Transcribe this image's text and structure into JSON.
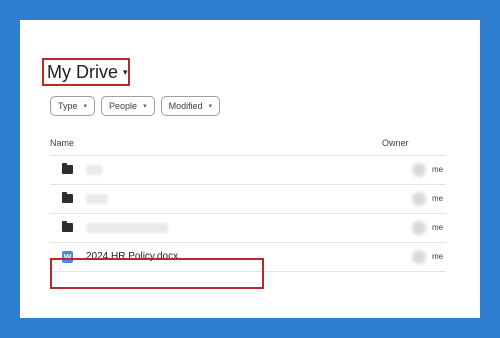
{
  "header": {
    "title": "My Drive",
    "title_caret": "▾"
  },
  "filters": [
    {
      "label": "Type",
      "caret": "▾"
    },
    {
      "label": "People",
      "caret": "▾"
    },
    {
      "label": "Modified",
      "caret": "▾"
    }
  ],
  "columns": {
    "name": "Name",
    "owner": "Owner"
  },
  "rows": [
    {
      "type": "folder",
      "name": "",
      "owner": "me"
    },
    {
      "type": "folder",
      "name": "",
      "owner": "me"
    },
    {
      "type": "folder",
      "name": "",
      "owner": "me"
    },
    {
      "type": "word-document",
      "icon_letter": "W",
      "name": "2024 HR Policy.docx",
      "owner": "me"
    }
  ],
  "colors": {
    "background": "#2f7fd0",
    "highlight": "#b72a2a",
    "word_icon": "#4a86e8"
  }
}
